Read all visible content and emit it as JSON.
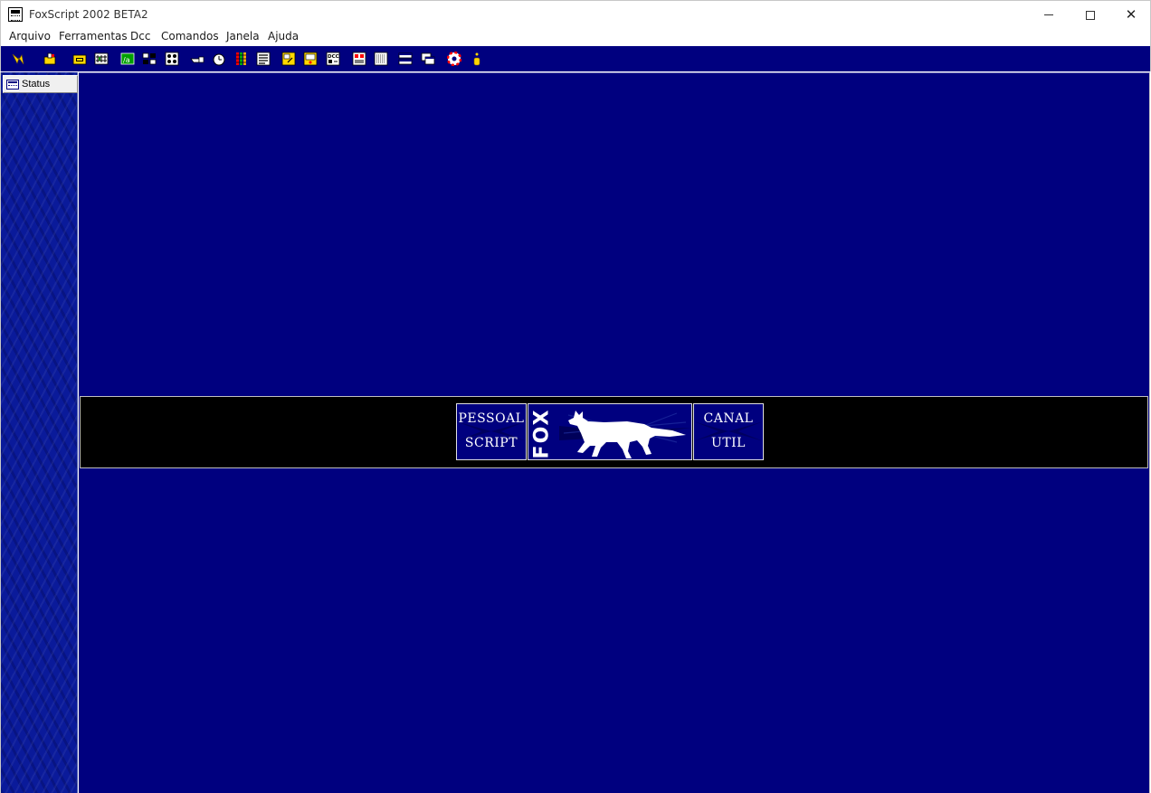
{
  "window": {
    "title": "FoxScript 2002 BETA2",
    "controls": {
      "minimize": "minimize",
      "maximize": "maximize",
      "close": "✕"
    }
  },
  "menu": [
    "Arquivo",
    "Ferramentas",
    "Dcc",
    "Comandos",
    "Janela",
    "Ajuda"
  ],
  "toolbar": {
    "icons": [
      "connect-icon",
      "options-icon",
      "open-icon",
      "channels-icon",
      "script-editor-icon",
      "address-book-icon",
      "notify-icon",
      "finger-icon",
      "timer-icon",
      "colors-icon",
      "urls-icon",
      "dcc-send-icon",
      "dcc-chat-icon",
      "dcc-options-icon",
      "received-files-icon",
      "logs-icon",
      "tile-icon",
      "cascade-icon",
      "help-icon",
      "info-icon"
    ]
  },
  "switchbar": {
    "status_tab": "Status"
  },
  "banner": {
    "left": {
      "line1": "PESSOAL",
      "line2": "SCRIPT"
    },
    "center": {
      "word": "FOX"
    },
    "right": {
      "line1": "CANAL",
      "line2": "UTIL"
    }
  },
  "colors": {
    "background": "#00007f",
    "banner": "#000000",
    "text": "#ffffff"
  }
}
